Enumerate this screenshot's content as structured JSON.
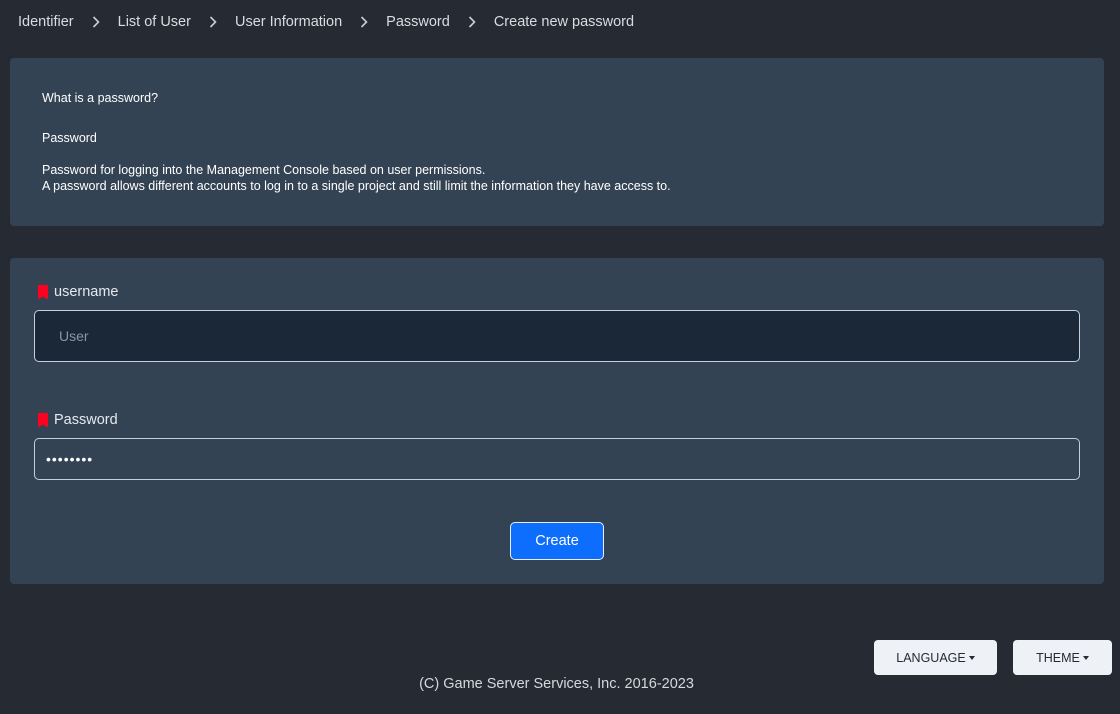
{
  "breadcrumb": {
    "items": [
      "Identifier",
      "List of User",
      "User Information",
      "Password",
      "Create new password"
    ]
  },
  "info": {
    "question": "What is a password?",
    "term": "Password",
    "desc_line1": "Password for logging into the Management Console based on user permissions.",
    "desc_line2": "A password allows different accounts to log in to a single project and still limit the information they have access to."
  },
  "form": {
    "username_label": "username",
    "username_placeholder": "User",
    "username_value": "",
    "password_label": "Password",
    "password_value": "••••••••",
    "create_label": "Create",
    "required_marker_color": "#ff0020"
  },
  "footer": {
    "language_label": "LANGUAGE",
    "theme_label": "THEME",
    "copyright": "(C) Game Server Services, Inc. 2016-2023"
  },
  "colors": {
    "background": "#252a33",
    "panel": "#334354",
    "primary_button": "#0d6efd"
  }
}
